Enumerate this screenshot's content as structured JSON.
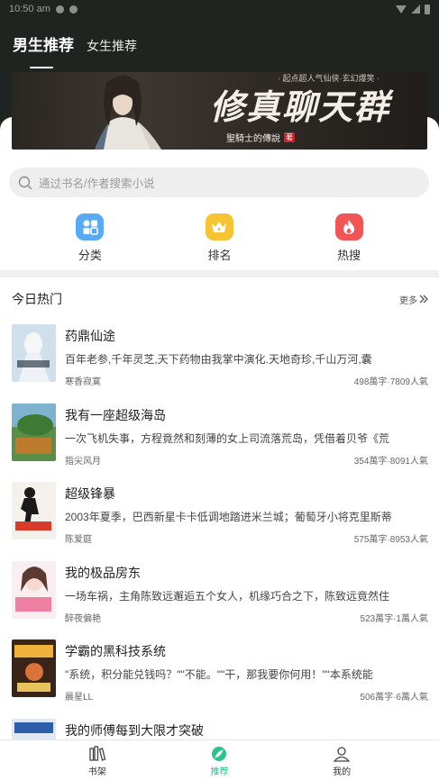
{
  "status": {
    "time": "10:50 am"
  },
  "header": {
    "tabs": [
      {
        "label": "男生推荐",
        "active": true
      },
      {
        "label": "女生推荐",
        "active": false
      }
    ]
  },
  "banner": {
    "title": "修真聊天群",
    "subtitle": "· 起点超人气仙侠·玄幻爆笑 ·",
    "author": "聖騎士的傳說",
    "seal": "著"
  },
  "search": {
    "placeholder": "通过书名/作者搜索小说"
  },
  "quick": [
    {
      "label": "分类",
      "icon": "category-icon",
      "color": "#5aa9f5"
    },
    {
      "label": "排名",
      "icon": "crown-icon",
      "color": "#f6c333"
    },
    {
      "label": "热搜",
      "icon": "flame-icon",
      "color": "#f25555"
    }
  ],
  "section": {
    "title": "今日热门",
    "more": "更多"
  },
  "books": [
    {
      "title": "药鼎仙途",
      "desc": "百年老参,千年灵芝,天下药物由我掌中演化.天地奇珍,千山万河,囊",
      "author": "寒香寂寞",
      "meta": "498萬字·7809人氣"
    },
    {
      "title": "我有一座超级海岛",
      "desc": "一次飞机失事，方程竟然和刻薄的女上司流落荒岛，凭借着贝爷《荒",
      "author": "指尖风月",
      "meta": "354萬字·8091人氣"
    },
    {
      "title": "超级锋暴",
      "desc": "2003年夏季，巴西新星卡卡低调地踏进米兰城；葡萄牙小将克里斯蒂",
      "author": "陈爱庭",
      "meta": "575萬字·8953人氣"
    },
    {
      "title": "我的极品房东",
      "desc": "一场车祸，主角陈致远邂逅五个女人，机缘巧合之下，陈致远竟然住",
      "author": "醉夜偏艳",
      "meta": "523萬字·1萬人氣"
    },
    {
      "title": "学霸的黑科技系统",
      "desc": "\"系统，积分能兑钱吗？\"\"不能。\"\"干，那我要你何用！\"\"本系统能",
      "author": "晨星LL",
      "meta": "506萬字·6萬人氣"
    },
    {
      "title": "我的师傅每到大限才突破",
      "desc": "",
      "author": "",
      "meta": ""
    }
  ],
  "bottom_nav": [
    {
      "label": "书架",
      "icon": "bookshelf-icon",
      "active": false
    },
    {
      "label": "推荐",
      "icon": "feather-icon",
      "active": true
    },
    {
      "label": "我的",
      "icon": "user-icon",
      "active": false
    }
  ],
  "colors": {
    "accent": "#2bc48a",
    "header_bg": "#1f2420"
  }
}
